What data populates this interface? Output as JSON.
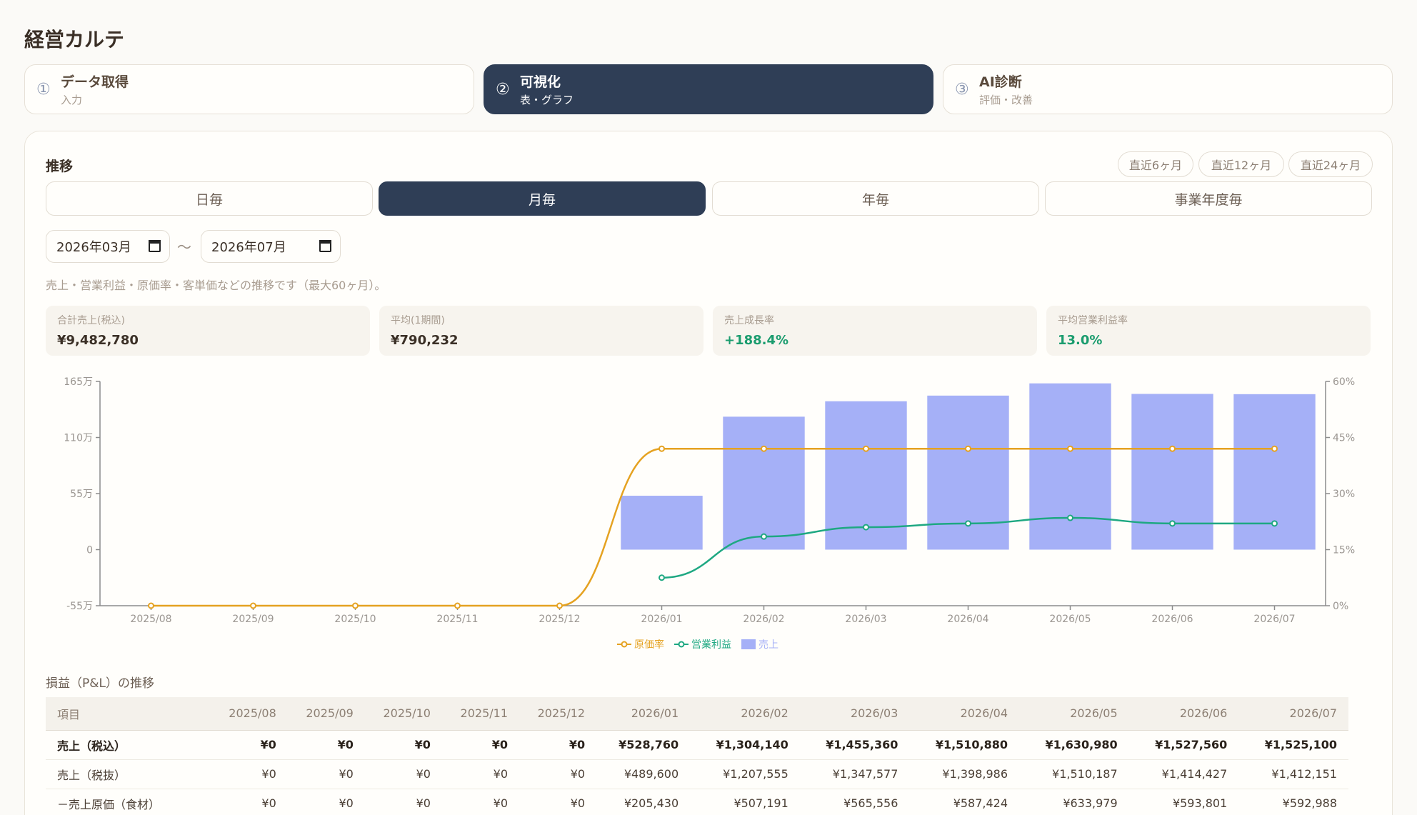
{
  "app_title": "経営カルテ",
  "steps": [
    {
      "num": "①",
      "label": "データ取得",
      "sub": "入力"
    },
    {
      "num": "②",
      "label": "可視化",
      "sub": "表・グラフ"
    },
    {
      "num": "③",
      "label": "AI診断",
      "sub": "評価・改善"
    }
  ],
  "trend": {
    "label": "推移",
    "quick_ranges": [
      "直近6ヶ月",
      "直近12ヶ月",
      "直近24ヶ月"
    ],
    "granularity": [
      "日毎",
      "月毎",
      "年毎",
      "事業年度毎"
    ],
    "selected_granularity": "月毎",
    "date_from": "2026年03月",
    "date_to": "2026年07月",
    "range_separator": "～",
    "note": "売上・営業利益・原価率・客単価などの推移です（最大60ヶ月）。"
  },
  "kpis": [
    {
      "label": "合計売上(税込)",
      "value": "¥9,482,780",
      "color": "#3a2f26"
    },
    {
      "label": "平均(1期間)",
      "value": "¥790,232",
      "color": "#3a2f26"
    },
    {
      "label": "売上成長率",
      "value": "+188.4%",
      "color": "#1a9c6e"
    },
    {
      "label": "平均営業利益率",
      "value": "13.0%",
      "color": "#1a9c6e"
    }
  ],
  "chart_data": {
    "type": "bar",
    "categories": [
      "2025/08",
      "2025/09",
      "2025/10",
      "2025/11",
      "2025/12",
      "2026/01",
      "2026/02",
      "2026/03",
      "2026/04",
      "2026/05",
      "2026/06",
      "2026/07"
    ],
    "left_axis": {
      "ticks": [
        "165万",
        "110万",
        "55万",
        "0",
        "-55万"
      ],
      "values": [
        1650000,
        1100000,
        550000,
        0,
        -550000
      ],
      "ylim": [
        -550000,
        1650000
      ]
    },
    "right_axis": {
      "ticks": [
        "60%",
        "45%",
        "30%",
        "15%",
        "0%"
      ],
      "values": [
        60,
        45,
        30,
        15,
        0
      ],
      "ylim": [
        0,
        60
      ]
    },
    "series": [
      {
        "name": "売上",
        "type": "bar",
        "axis": "left",
        "color": "#a5b0f7",
        "values": [
          0,
          0,
          0,
          0,
          0,
          528760,
          1304140,
          1455360,
          1510880,
          1630980,
          1527560,
          1525100
        ]
      },
      {
        "name": "原価率",
        "type": "line",
        "axis": "right",
        "color": "#e5a221",
        "values": [
          0,
          0,
          0,
          0,
          0,
          42,
          42,
          42,
          42,
          42,
          42,
          42
        ]
      },
      {
        "name": "営業利益",
        "type": "line",
        "axis": "right",
        "color": "#1ea882",
        "values": [
          null,
          null,
          null,
          null,
          null,
          7.5,
          18.5,
          21,
          22,
          23.5,
          22,
          22
        ]
      }
    ],
    "legend": [
      "原価率",
      "営業利益",
      "売上"
    ],
    "legend_position": "bottom"
  },
  "pl": {
    "title": "損益（P&L）の推移",
    "columns": [
      "項目",
      "2025/08",
      "2025/09",
      "2025/10",
      "2025/11",
      "2025/12",
      "2026/01",
      "2026/02",
      "2026/03",
      "2026/04",
      "2026/05",
      "2026/06",
      "2026/07"
    ],
    "rows": [
      {
        "label": "売上（税込）",
        "values": [
          "¥0",
          "¥0",
          "¥0",
          "¥0",
          "¥0",
          "¥528,760",
          "¥1,304,140",
          "¥1,455,360",
          "¥1,510,880",
          "¥1,630,980",
          "¥1,527,560",
          "¥1,525,100"
        ]
      },
      {
        "label": "売上（税抜）",
        "values": [
          "¥0",
          "¥0",
          "¥0",
          "¥0",
          "¥0",
          "¥489,600",
          "¥1,207,555",
          "¥1,347,577",
          "¥1,398,986",
          "¥1,510,187",
          "¥1,414,427",
          "¥1,412,151"
        ]
      },
      {
        "label": "－売上原価（食材）",
        "values": [
          "¥0",
          "¥0",
          "¥0",
          "¥0",
          "¥0",
          "¥205,430",
          "¥507,191",
          "¥565,556",
          "¥587,424",
          "¥633,979",
          "¥593,801",
          "¥592,988"
        ]
      }
    ]
  }
}
